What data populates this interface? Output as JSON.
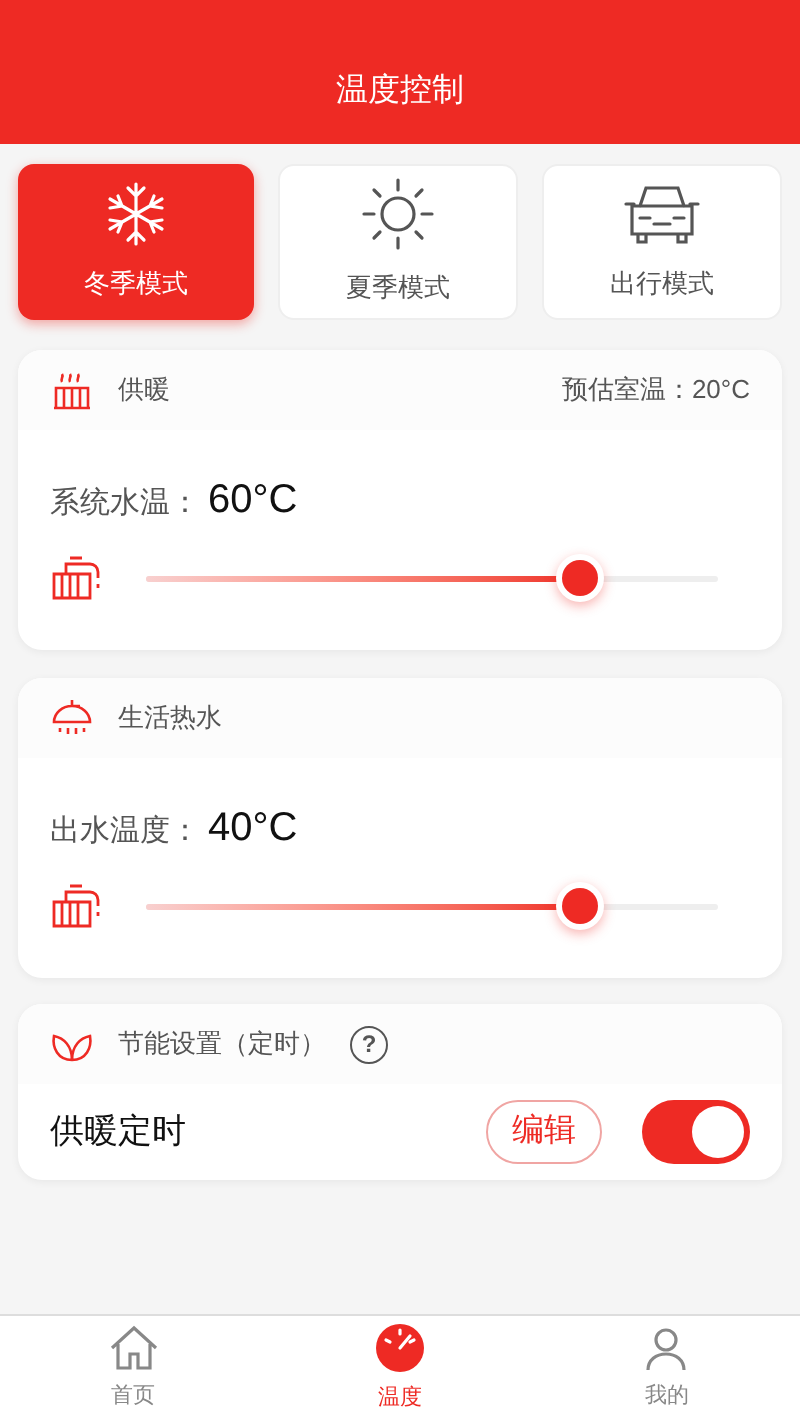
{
  "header": {
    "title": "温度控制"
  },
  "modes": [
    {
      "label": "冬季模式",
      "kind": "snowflake",
      "selected": true
    },
    {
      "label": "夏季模式",
      "kind": "sun",
      "selected": false
    },
    {
      "label": "出行模式",
      "kind": "car",
      "selected": false
    }
  ],
  "heating": {
    "title": "供暖",
    "estimate": "预估室温：20°C",
    "label": "系统水温：",
    "value": "60°C",
    "level": 0.76
  },
  "hot_water": {
    "title": "生活热水",
    "label": "出水温度：",
    "value": "40°C",
    "level": 0.76
  },
  "energy": {
    "title": "节能设置（定时）",
    "help": "?",
    "row_label": "供暖定时",
    "edit": "编辑",
    "on": true
  },
  "nav": [
    {
      "label": "首页",
      "kind": "home",
      "selected": false
    },
    {
      "label": "温度",
      "kind": "gauge",
      "selected": true
    },
    {
      "label": "我的",
      "kind": "user",
      "selected": false
    }
  ]
}
